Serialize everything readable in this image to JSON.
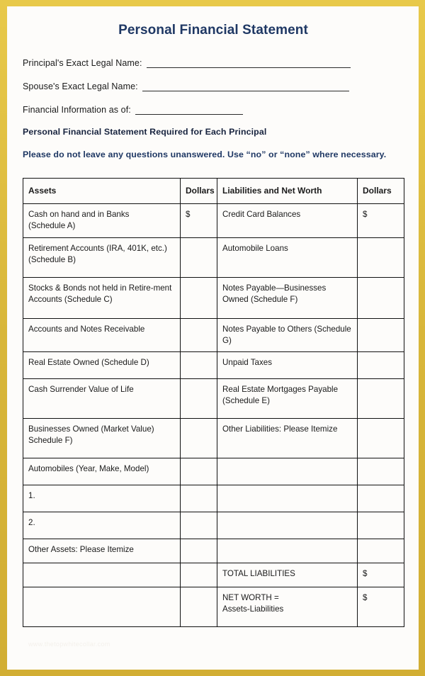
{
  "document": {
    "title": "Personal Financial Statement",
    "fields": [
      {
        "label": "Principal's Exact Legal Name:",
        "value": ""
      },
      {
        "label": "Spouse's Exact Legal Name:",
        "value": ""
      },
      {
        "label": "Financial Information as of:",
        "value": ""
      }
    ],
    "notices": [
      "Personal Financial Statement Required for Each Principal",
      "Please do not leave any questions unanswered. Use “no” or “none” where necessary."
    ],
    "watermark": "www.thetopwhitecollar.com"
  },
  "table": {
    "headers": [
      "Assets",
      "Dollars",
      "Liabilities and Net Worth",
      "Dollars"
    ],
    "rows": [
      {
        "asset": "Cash on hand and in Banks",
        "asset_line2": "(Schedule A)",
        "asset_dollars": "$",
        "liability": "Credit Card Balances",
        "liability_line2": "",
        "liability_dollars": "$"
      },
      {
        "asset": "Retirement Accounts (IRA, 401K, etc.)",
        "asset_line2": "(Schedule B)",
        "asset_dollars": "",
        "liability": "Automobile Loans",
        "liability_line2": "",
        "liability_dollars": ""
      },
      {
        "asset": "Stocks & Bonds not held in Retire-ment Accounts (Schedule C)",
        "asset_line2": "",
        "asset_dollars": "",
        "liability": "Notes Payable—Businesses Owned (Schedule F)",
        "liability_line2": "",
        "liability_dollars": ""
      },
      {
        "asset": "Accounts and Notes Receivable",
        "asset_line2": "",
        "asset_dollars": "",
        "liability": "Notes Payable to Others (Schedule G)",
        "liability_line2": "",
        "liability_dollars": ""
      },
      {
        "asset": "Real Estate Owned (Schedule D)",
        "asset_line2": "",
        "asset_dollars": "",
        "liability": "Unpaid Taxes",
        "liability_line2": "",
        "liability_dollars": ""
      },
      {
        "asset": "Cash Surrender Value of Life",
        "asset_line2": "",
        "asset_dollars": "",
        "liability": "Real Estate Mortgages Payable (Schedule E)",
        "liability_line2": "",
        "liability_dollars": ""
      },
      {
        "asset": "Businesses Owned (Market Value)",
        "asset_line2": "Schedule F)",
        "asset_dollars": "",
        "liability": "Other Liabilities: Please Itemize",
        "liability_line2": "",
        "liability_dollars": ""
      },
      {
        "asset": "Automobiles (Year, Make, Model)",
        "asset_line2": "",
        "asset_dollars": "",
        "liability": "",
        "liability_line2": "",
        "liability_dollars": ""
      },
      {
        "asset": "1.",
        "asset_line2": "",
        "asset_dollars": "",
        "liability": "",
        "liability_line2": "",
        "liability_dollars": ""
      },
      {
        "asset": "2.",
        "asset_line2": "",
        "asset_dollars": "",
        "liability": "",
        "liability_line2": "",
        "liability_dollars": ""
      },
      {
        "asset": "Other Assets: Please Itemize",
        "asset_line2": "",
        "asset_dollars": "",
        "liability": "",
        "liability_line2": "",
        "liability_dollars": ""
      },
      {
        "asset": "",
        "asset_line2": "",
        "asset_dollars": "",
        "liability": "TOTAL LIABILITIES",
        "liability_line2": "",
        "liability_dollars": "$"
      },
      {
        "asset": "",
        "asset_line2": "",
        "asset_dollars": "",
        "liability": "NET WORTH =",
        "liability_line2": "Assets-Liabilities",
        "liability_dollars": "$"
      }
    ]
  }
}
